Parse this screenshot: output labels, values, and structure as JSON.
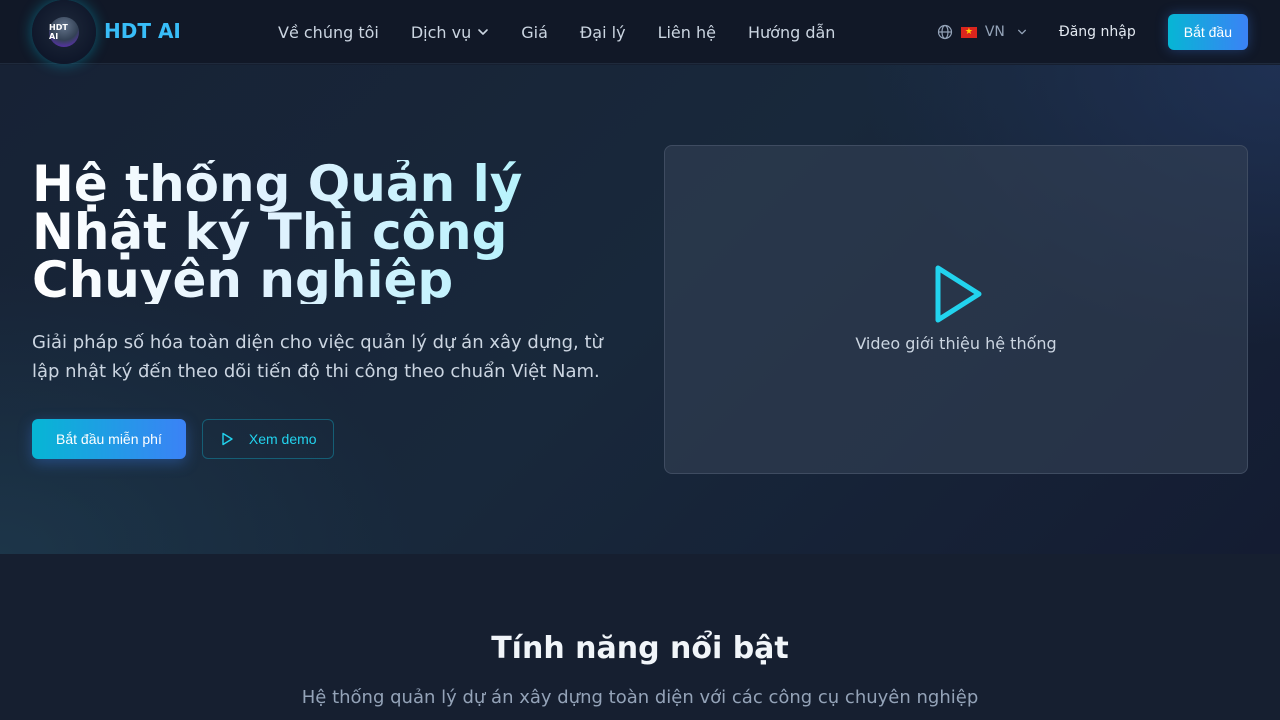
{
  "brand": {
    "logo_mark": "HDT AI",
    "name": "HDT AI",
    "accent": "#06b6d4"
  },
  "nav": {
    "links": [
      {
        "label": "Về chúng tôi"
      },
      {
        "label": "Dịch vụ",
        "has_dropdown": true
      },
      {
        "label": "Giá"
      },
      {
        "label": "Đại lý"
      },
      {
        "label": "Liên hệ"
      },
      {
        "label": "Hướng dẫn"
      }
    ],
    "language": {
      "code": "VN",
      "icon": "globe-icon",
      "flag": "vietnam-flag-icon"
    },
    "login_label": "Đăng nhập",
    "start_label": "Bắt đầu"
  },
  "hero": {
    "title_lines": [
      "Hệ thống Quản lý",
      "Nhật ký Thi công",
      "Chuyên nghiệp"
    ],
    "description": "Giải pháp số hóa toàn diện cho việc quản lý dự án xây dựng, từ lập nhật ký đến theo dõi tiến độ thi công theo chuẩn Việt Nam.",
    "primary_cta": "Bắt đầu miễn phí",
    "secondary_cta": "Xem demo",
    "video_caption": "Video giới thiệu hệ thống",
    "gradient": [
      "#06b6d4",
      "#3b82f6"
    ]
  },
  "features": {
    "title": "Tính năng nổi bật",
    "subtitle": "Hệ thống quản lý dự án xây dựng toàn diện với các công cụ chuyên nghiệp"
  }
}
